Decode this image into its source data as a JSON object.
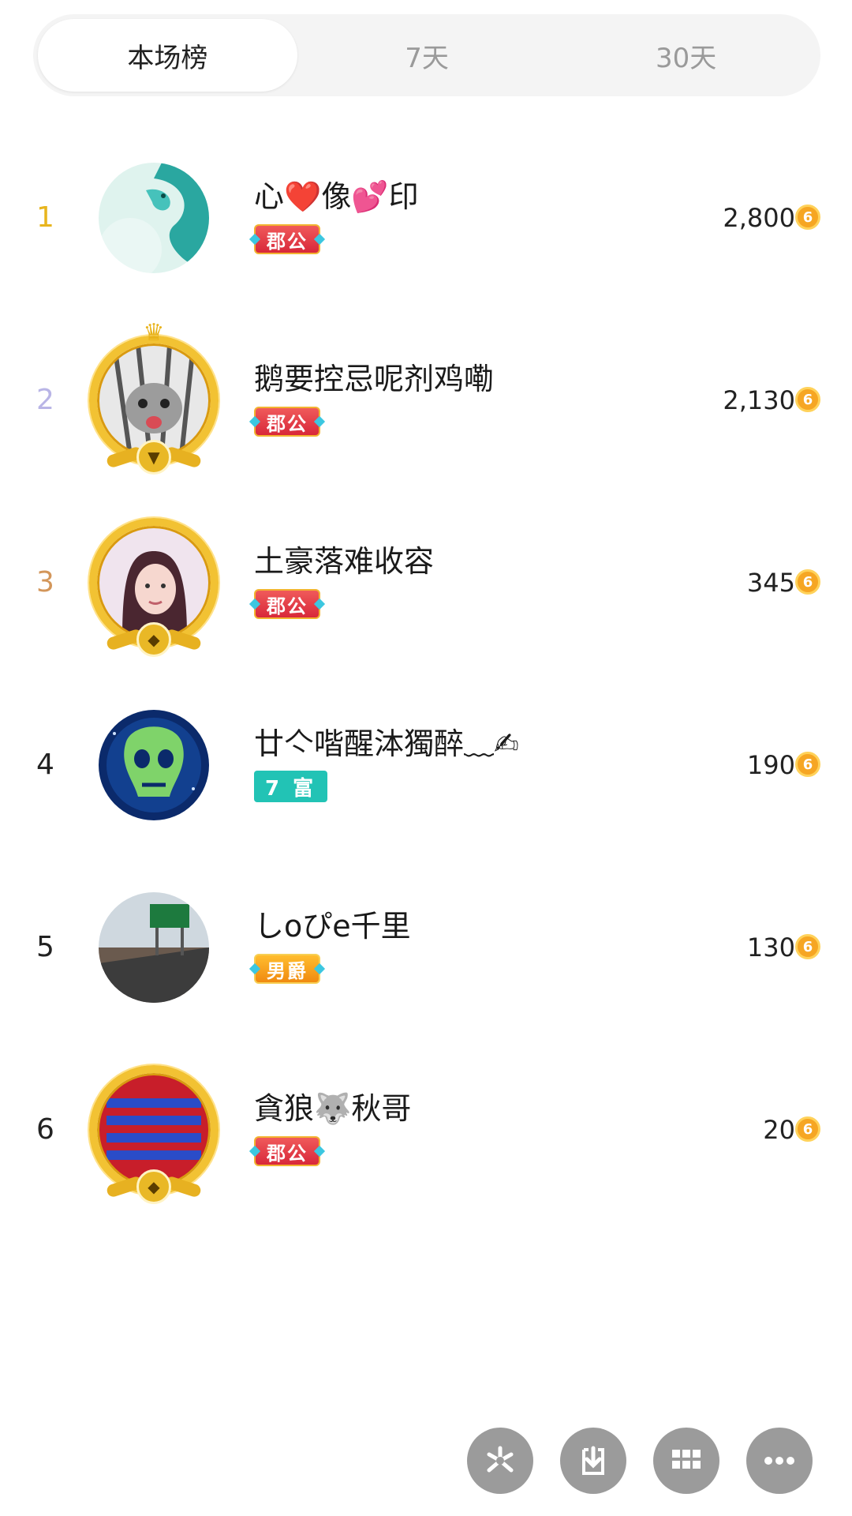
{
  "tabs": [
    {
      "label": "本场榜",
      "active": true
    },
    {
      "label": "7天",
      "active": false
    },
    {
      "label": "30天",
      "active": false
    }
  ],
  "colors": {
    "rank1": "#e8b51e",
    "rank2": "#b9b5e6",
    "rank3": "#d3965a",
    "rank_default": "#222222",
    "badge_teal": "#22c3b5",
    "coin": "#f6a623"
  },
  "coin_label": "6",
  "entries": [
    {
      "rank": "1",
      "name": "心❤️像💕印",
      "badge": "郡公",
      "score": "2,800"
    },
    {
      "rank": "2",
      "name": "鹅要控忌呢剂鸡嘞",
      "badge": "郡公",
      "score": "2,130"
    },
    {
      "rank": "3",
      "name": "土豪落难收容",
      "badge": "郡公",
      "score": "345"
    },
    {
      "rank": "4",
      "name": "廿亽喈醒泍獨醉﹏✍",
      "badge": "7 富",
      "score": "190"
    },
    {
      "rank": "5",
      "name": "しoぴe千里",
      "badge": "男爵",
      "score": "130"
    },
    {
      "rank": "6",
      "name": "貪狼🐺秋哥",
      "badge": "郡公",
      "score": "20"
    }
  ],
  "actions": [
    {
      "icon": "flower-icon"
    },
    {
      "icon": "download-icon"
    },
    {
      "icon": "grid-icon"
    },
    {
      "icon": "more-icon"
    }
  ]
}
